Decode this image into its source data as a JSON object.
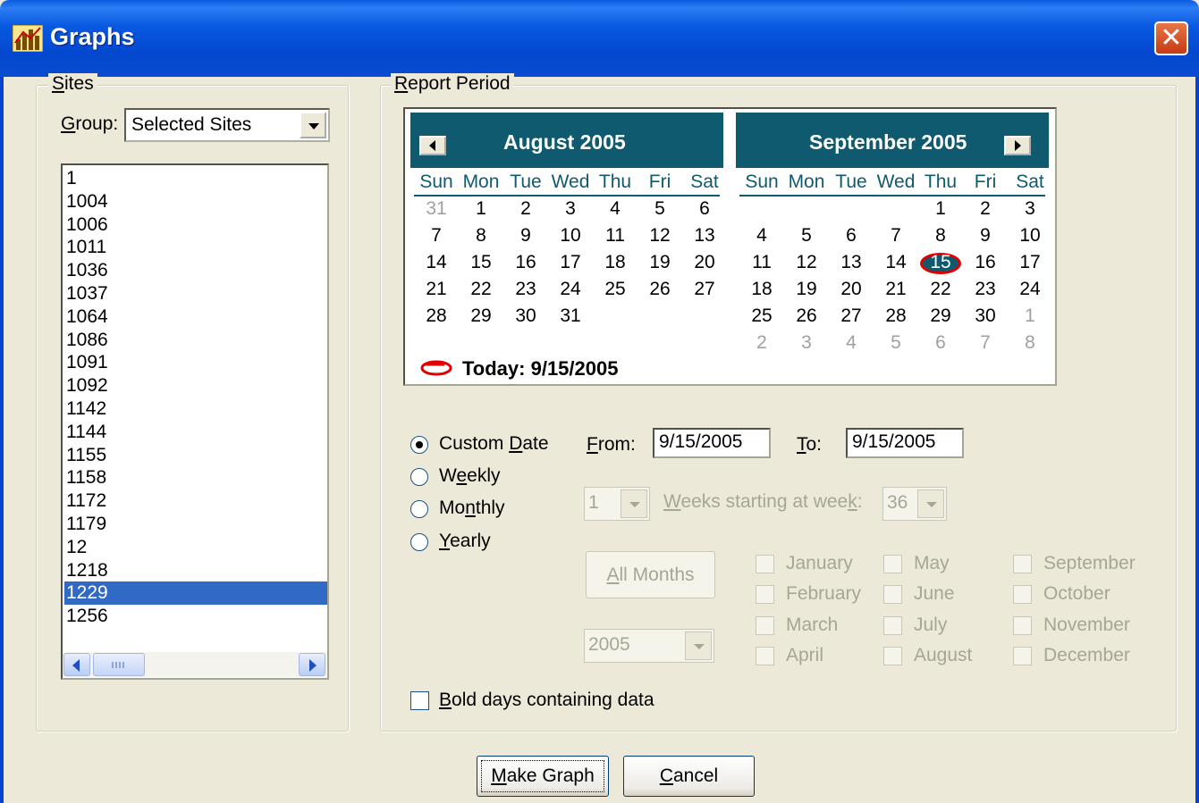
{
  "window": {
    "title": "Graphs",
    "icon": "graph-icon",
    "close_icon": "close-icon"
  },
  "sites": {
    "legend_first": "S",
    "legend_rest": "ites",
    "group_label_first": "G",
    "group_label_rest": "roup:",
    "group_value": "Selected Sites",
    "items": [
      "1",
      "1004",
      "1006",
      "1011",
      "1036",
      "1037",
      "1064",
      "1086",
      "1091",
      "1092",
      "1142",
      "1144",
      "1155",
      "1158",
      "1172",
      "1179",
      "12",
      "1218",
      "1229",
      "1256"
    ],
    "selected_item": "1229"
  },
  "report": {
    "legend_first": "R",
    "legend_rest": "eport Period",
    "calendar": {
      "left_title": "August 2005",
      "right_title": "September 2005",
      "day_names": [
        "Sun",
        "Mon",
        "Tue",
        "Wed",
        "Thu",
        "Fri",
        "Sat"
      ],
      "august_rows": [
        [
          "31",
          "1",
          "2",
          "3",
          "4",
          "5",
          "6"
        ],
        [
          "7",
          "8",
          "9",
          "10",
          "11",
          "12",
          "13"
        ],
        [
          "14",
          "15",
          "16",
          "17",
          "18",
          "19",
          "20"
        ],
        [
          "21",
          "22",
          "23",
          "24",
          "25",
          "26",
          "27"
        ],
        [
          "28",
          "29",
          "30",
          "31",
          "",
          "",
          ""
        ]
      ],
      "september_rows": [
        [
          "",
          "",
          "",
          "",
          "1",
          "2",
          "3"
        ],
        [
          "4",
          "5",
          "6",
          "7",
          "8",
          "9",
          "10"
        ],
        [
          "11",
          "12",
          "13",
          "14",
          "15",
          "16",
          "17"
        ],
        [
          "18",
          "19",
          "20",
          "21",
          "22",
          "23",
          "24"
        ],
        [
          "25",
          "26",
          "27",
          "28",
          "29",
          "30",
          "1"
        ],
        [
          "2",
          "3",
          "4",
          "5",
          "6",
          "7",
          "8"
        ]
      ],
      "today_label": "Today: 9/15/2005",
      "today_day": "15"
    },
    "radios": [
      {
        "label_pre": "Custom ",
        "label_u": "D",
        "label_post": "ate",
        "checked": true
      },
      {
        "label_pre": "W",
        "label_u": "e",
        "label_post": "ekly",
        "checked": false
      },
      {
        "label_pre": "Mo",
        "label_u": "n",
        "label_post": "thly",
        "checked": false
      },
      {
        "label_pre": "",
        "label_u": "Y",
        "label_post": "early",
        "checked": false
      }
    ],
    "from_label_u": "F",
    "from_label_rest": "rom:",
    "from_value": "9/15/2005",
    "to_label_u": "T",
    "to_label_rest": "o:",
    "to_value": "9/15/2005",
    "weeks_count": "1",
    "weeks_label_u": "W",
    "weeks_label_mid": "eeks starting at wee",
    "weeks_label_u2": "k",
    "weeks_label_end": ":",
    "week_start": "36",
    "all_months_u": "A",
    "all_months_rest": "ll Months",
    "year_value": "2005",
    "months": [
      [
        "January",
        "May",
        "September"
      ],
      [
        "February",
        "June",
        "October"
      ],
      [
        "March",
        "July",
        "November"
      ],
      [
        "April",
        "August",
        "December"
      ]
    ],
    "bold_days_u": "B",
    "bold_days_rest": "old days containing data",
    "bold_days_checked": false
  },
  "buttons": {
    "make_graph_u": "M",
    "make_graph_rest": "ake Graph",
    "cancel_u": "C",
    "cancel_rest": "ancel"
  },
  "colors": {
    "title_blue": "#0858E0",
    "calendar_teal": "#0F5A6E",
    "selection": "#316AC5",
    "today_ring": "#E00000"
  }
}
